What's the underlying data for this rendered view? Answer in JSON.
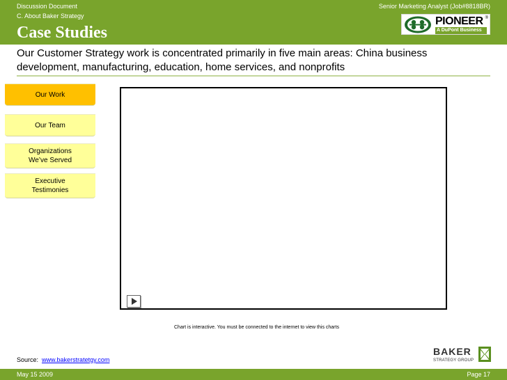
{
  "header": {
    "doc_label": "Discussion Document",
    "section_label": "C. About Baker Strategy",
    "job_label": "Senior Marketing Analyst (Job#8818BR)",
    "title": "Case Studies",
    "background_color": "#79a42c"
  },
  "pioneer_logo": {
    "name": "PIONEER",
    "tagline": "A DuPont Business",
    "registered": "®"
  },
  "subtitle": "Our Customer Strategy work is concentrated primarily in five main areas: China business development, manufacturing, education, home services, and nonprofits",
  "nav": {
    "items": [
      {
        "label": "Our Work",
        "active": true
      },
      {
        "label": "Our Team",
        "active": false
      },
      {
        "label": "Organizations We’ve Served",
        "active": false
      },
      {
        "label": "Executive Testimonies",
        "active": false
      }
    ],
    "active_color": "#ffc000",
    "idle_color": "#ffff99"
  },
  "chart": {
    "note": "Chart is interactive.  You must be connected to the internet to view this charts",
    "play_icon": "play-icon"
  },
  "source": {
    "prefix": "Source:",
    "link_text": "www.bakerstratetgy.com"
  },
  "baker_logo": {
    "name": "BAKER",
    "sub": "STRATEGY GROUP"
  },
  "footer": {
    "date": "May 15 2009",
    "page": "Page 17"
  }
}
